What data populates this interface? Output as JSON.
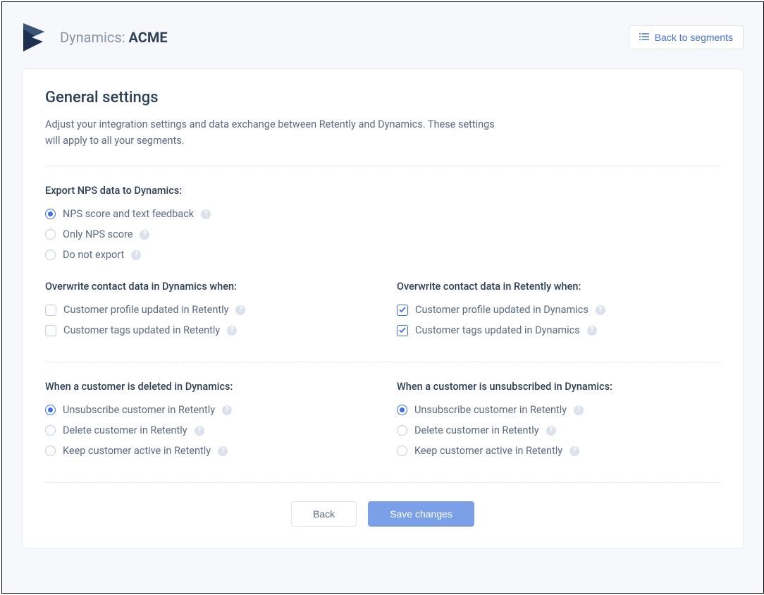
{
  "header": {
    "breadcrumb_prefix": "Dynamics: ",
    "breadcrumb_name": "ACME",
    "back_label": "Back to segments"
  },
  "settings": {
    "title": "General settings",
    "subtitle": "Adjust your integration settings and data exchange between Retently and Dynamics. These settings will apply to all your segments."
  },
  "export": {
    "label": "Export NPS data to Dynamics:",
    "opt1": "NPS score and text feedback",
    "opt2": "Only NPS score",
    "opt3": "Do not export"
  },
  "overwrite_dynamics": {
    "label": "Overwrite contact data in Dynamics when:",
    "opt1": "Customer profile updated in Retently",
    "opt2": "Customer tags updated in Retently"
  },
  "overwrite_retently": {
    "label": "Overwrite contact data in Retently when:",
    "opt1": "Customer profile updated in Dynamics",
    "opt2": "Customer tags updated in Dynamics"
  },
  "deleted": {
    "label": "When a customer is deleted in Dynamics:",
    "opt1": "Unsubscribe customer in Retently",
    "opt2": "Delete customer in Retently",
    "opt3": "Keep customer active in Retently"
  },
  "unsubscribed": {
    "label": "When a customer is unsubscribed in Dynamics:",
    "opt1": "Unsubscribe customer in Retently",
    "opt2": "Delete customer in Retently",
    "opt3": "Keep customer active in Retently"
  },
  "actions": {
    "back": "Back",
    "save": "Save changes"
  }
}
